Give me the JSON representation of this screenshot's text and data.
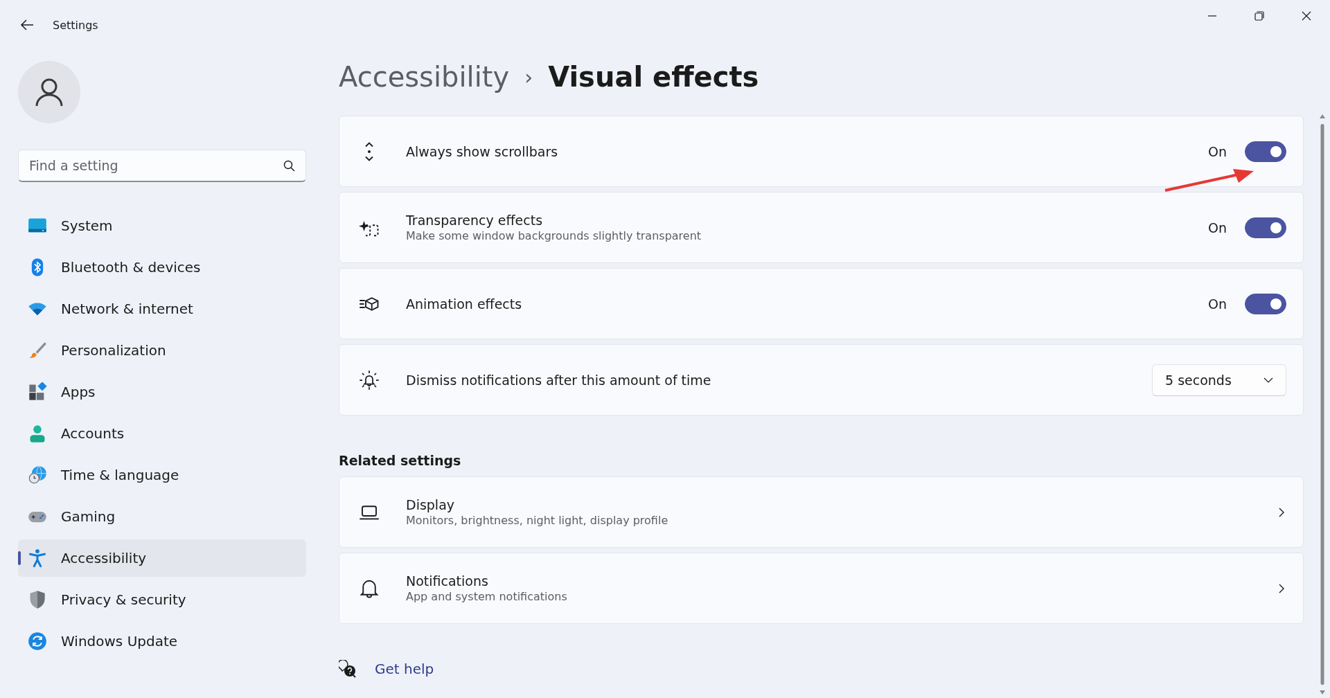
{
  "window": {
    "title": "Settings"
  },
  "sidebar": {
    "search": {
      "placeholder": "Find a setting"
    },
    "items": [
      {
        "label": "System",
        "selected": false
      },
      {
        "label": "Bluetooth & devices",
        "selected": false
      },
      {
        "label": "Network & internet",
        "selected": false
      },
      {
        "label": "Personalization",
        "selected": false
      },
      {
        "label": "Apps",
        "selected": false
      },
      {
        "label": "Accounts",
        "selected": false
      },
      {
        "label": "Time & language",
        "selected": false
      },
      {
        "label": "Gaming",
        "selected": false
      },
      {
        "label": "Accessibility",
        "selected": true
      },
      {
        "label": "Privacy & security",
        "selected": false
      },
      {
        "label": "Windows Update",
        "selected": false
      }
    ]
  },
  "breadcrumb": {
    "parent": "Accessibility",
    "separator": "›",
    "current": "Visual effects"
  },
  "settings": [
    {
      "kind": "toggle",
      "title": "Always show scrollbars",
      "state_label": "On",
      "on": true
    },
    {
      "kind": "toggle",
      "title": "Transparency effects",
      "description": "Make some window backgrounds slightly transparent",
      "state_label": "On",
      "on": true
    },
    {
      "kind": "toggle",
      "title": "Animation effects",
      "state_label": "On",
      "on": true
    },
    {
      "kind": "dropdown",
      "title": "Dismiss notifications after this amount of time",
      "value": "5 seconds"
    }
  ],
  "related": {
    "heading": "Related settings",
    "items": [
      {
        "title": "Display",
        "description": "Monitors, brightness, night light, display profile"
      },
      {
        "title": "Notifications",
        "description": "App and system notifications"
      }
    ]
  },
  "help": {
    "label": "Get help"
  }
}
